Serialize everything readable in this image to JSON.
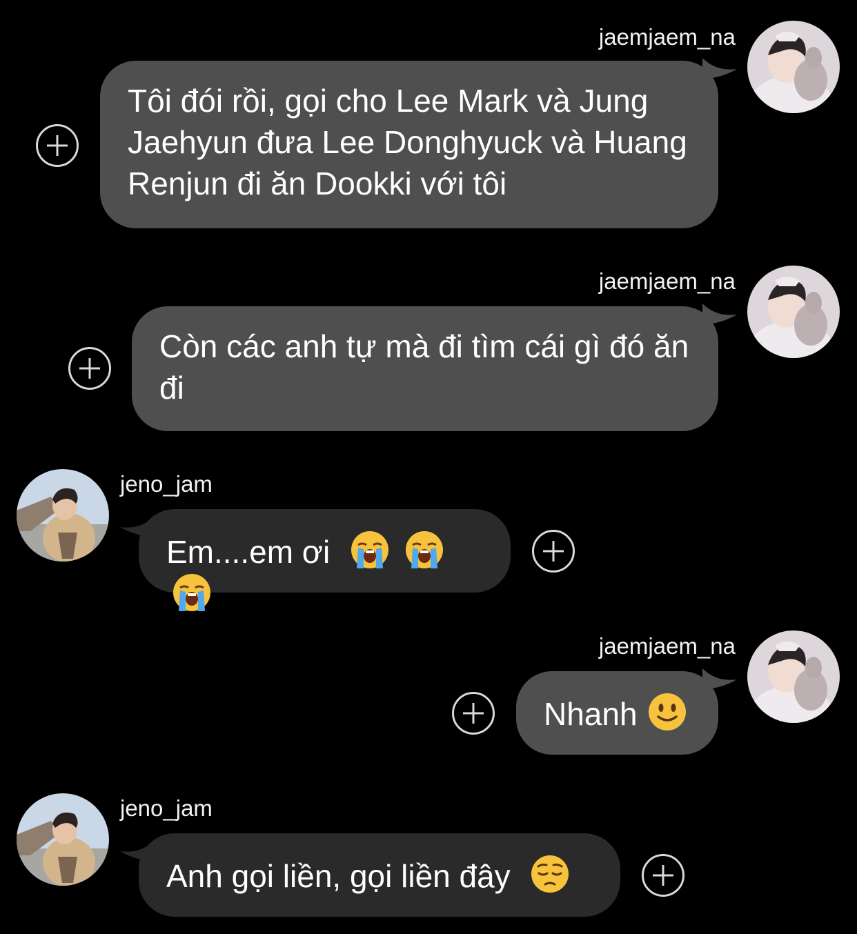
{
  "messages": [
    {
      "username": "jaemjaem_na",
      "avatar_icon": "profile-photo-avatar",
      "text": "Tôi đói rồi, gọi cho Lee Mark và Jung Jaehyun đưa Lee Donghyuck và Huang Renjun đi ăn Dookki với tôi",
      "emojis": []
    },
    {
      "username": "jaemjaem_na",
      "avatar_icon": "profile-photo-avatar",
      "text": "Còn các anh tự mà đi tìm cái gì đó ăn đi",
      "emojis": []
    },
    {
      "username": "jeno_jam",
      "avatar_icon": "profile-photo-avatar",
      "text": "Em....em ơi",
      "emojis": [
        "loudly-crying-face",
        "loudly-crying-face",
        "loudly-crying-face"
      ]
    },
    {
      "username": "jaemjaem_na",
      "avatar_icon": "profile-photo-avatar",
      "text": "Nhanh",
      "emojis": [
        "slightly-smiling-face"
      ]
    },
    {
      "username": "jeno_jam",
      "avatar_icon": "profile-photo-avatar",
      "text": "Anh gọi liền, gọi liền đây",
      "emojis": [
        "pensive-face"
      ]
    }
  ],
  "colors": {
    "background": "#000000",
    "outgoing_bubble": "#4f4f4f",
    "incoming_bubble": "#2a2a2a",
    "text": "#ffffff",
    "add_reaction_icon": "#d9d9d9"
  },
  "icons": {
    "add_reaction": "plus-circle-icon"
  }
}
